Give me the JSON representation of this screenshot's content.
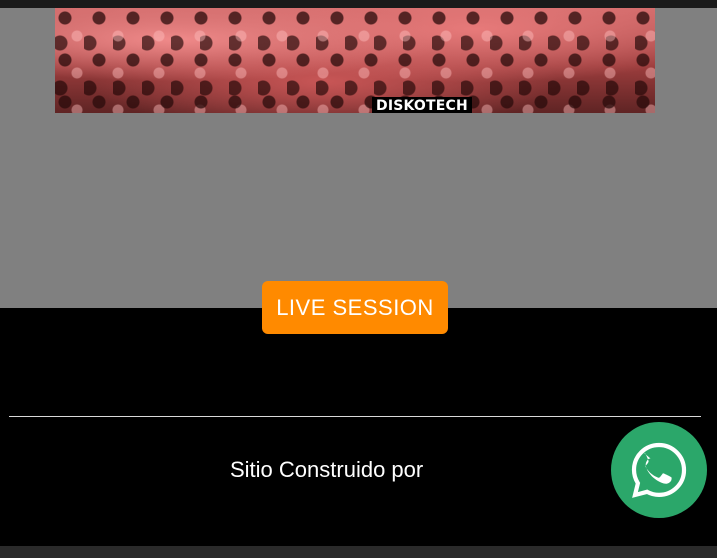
{
  "hero": {
    "label": "DISKOTECH"
  },
  "actions": {
    "live_session_label": "LIVE SESSION"
  },
  "footer": {
    "credit_text": "Sitio Construido por"
  },
  "icons": {
    "whatsapp": "whatsapp-icon"
  },
  "colors": {
    "accent": "#ff8a00",
    "gray_section": "#808080",
    "footer_background": "#000000",
    "whatsapp_green": "#2ba76a"
  }
}
